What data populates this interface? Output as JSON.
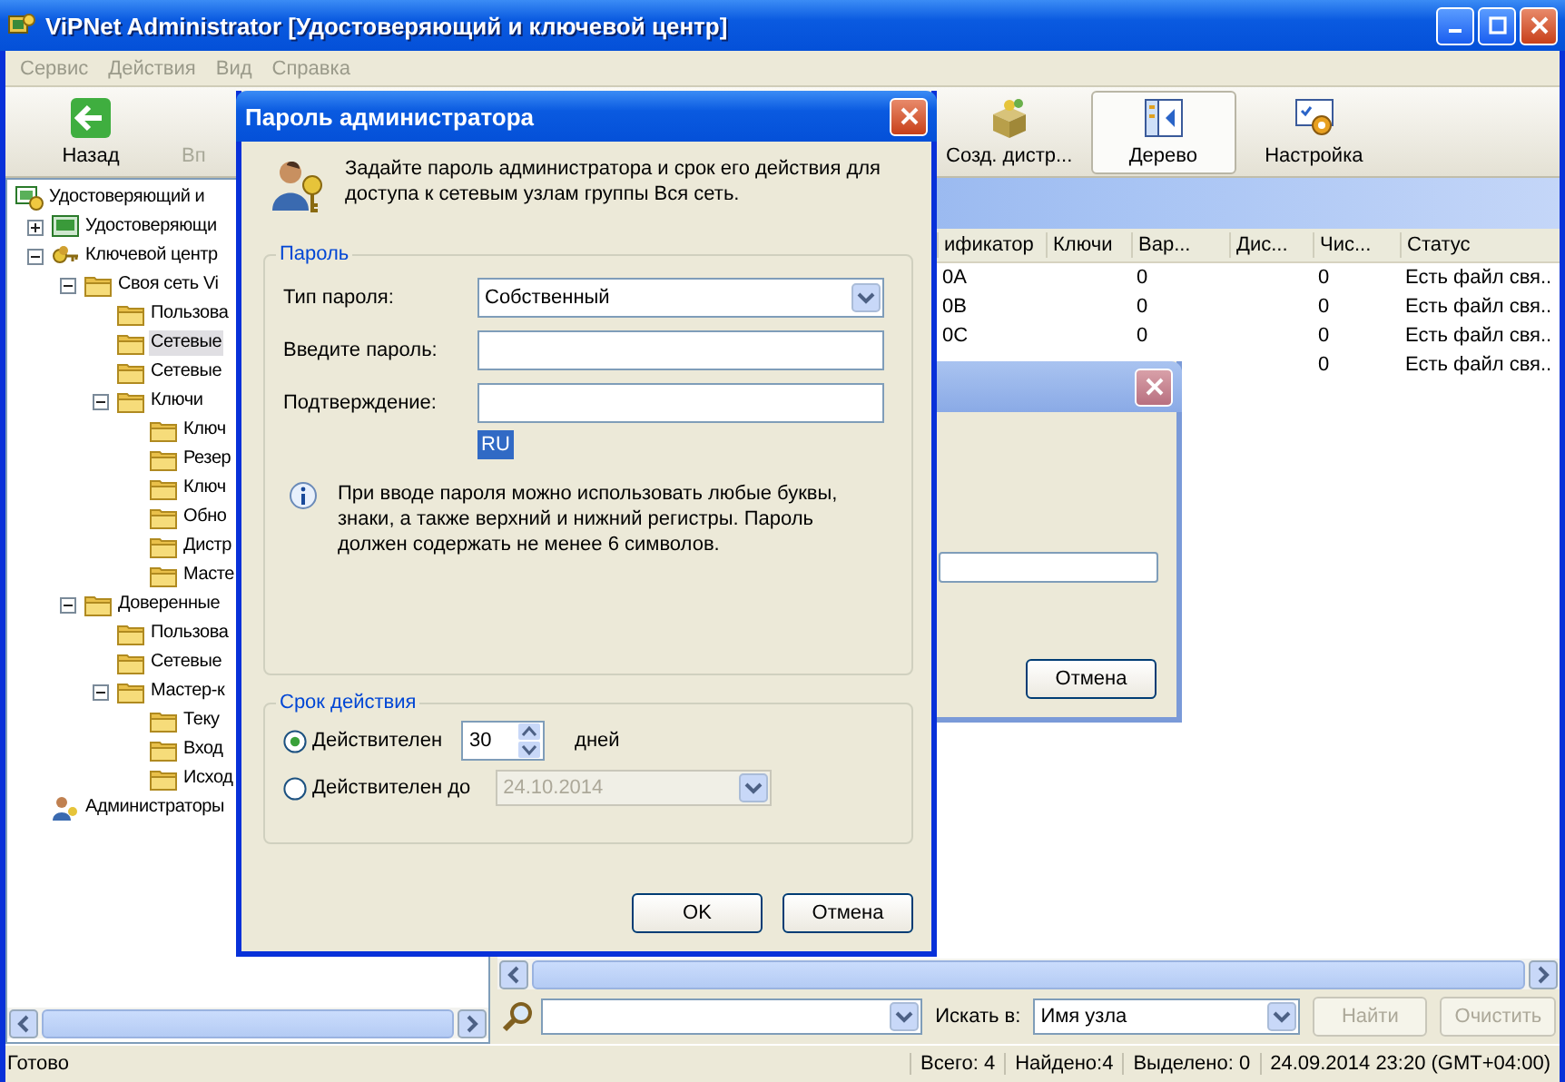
{
  "window": {
    "title": "ViPNet Administrator [Удостоверяющий и ключевой центр]"
  },
  "menu": [
    {
      "label": "Сервис",
      "disabled": true
    },
    {
      "label": "Действия",
      "disabled": true
    },
    {
      "label": "Вид",
      "disabled": true
    },
    {
      "label": "Справка",
      "disabled": true
    }
  ],
  "toolbar": {
    "left": [
      {
        "label": "Назад",
        "disabled": false,
        "selected": false
      },
      {
        "label": "Вп",
        "disabled": true,
        "selected": false
      }
    ],
    "right": [
      {
        "label": "Созд. дистр...",
        "disabled": false,
        "selected": false
      },
      {
        "label": "Дерево",
        "disabled": false,
        "selected": true
      },
      {
        "label": "Настройка",
        "disabled": false,
        "selected": false
      }
    ]
  },
  "tree": [
    {
      "label": "Удостоверяющий и",
      "kind": "root",
      "selected": false,
      "children": [
        {
          "label": "Удостоверяющи",
          "kind": "center",
          "selected": false,
          "expanded": false
        },
        {
          "label": "Ключевой центр",
          "kind": "keys",
          "selected": false,
          "expanded": true,
          "children": [
            {
              "label": "Своя сеть Vi",
              "kind": "folder",
              "selected": false,
              "expanded": true,
              "children": [
                {
                  "label": "Пользова",
                  "kind": "folder",
                  "selected": false
                },
                {
                  "label": "Сетевые",
                  "kind": "folder",
                  "selected": true
                },
                {
                  "label": "Сетевые",
                  "kind": "folder",
                  "selected": false
                },
                {
                  "label": "Ключи",
                  "kind": "folder",
                  "selected": false,
                  "expanded": true,
                  "children": [
                    {
                      "label": "Ключ",
                      "kind": "folder",
                      "selected": false
                    },
                    {
                      "label": "Резер",
                      "kind": "folder",
                      "selected": false
                    },
                    {
                      "label": "Ключ",
                      "kind": "folder",
                      "selected": false
                    },
                    {
                      "label": "Обно",
                      "kind": "folder",
                      "selected": false
                    },
                    {
                      "label": "Дистр",
                      "kind": "folder",
                      "selected": false
                    },
                    {
                      "label": "Масте",
                      "kind": "folder",
                      "selected": false
                    }
                  ]
                }
              ]
            },
            {
              "label": "Доверенные",
              "kind": "folder",
              "selected": false,
              "expanded": true,
              "children": [
                {
                  "label": "Пользова",
                  "kind": "folder",
                  "selected": false
                },
                {
                  "label": "Сетевые",
                  "kind": "folder",
                  "selected": false
                },
                {
                  "label": "Мастер-к",
                  "kind": "folder",
                  "selected": false,
                  "expanded": true,
                  "children": [
                    {
                      "label": "Теку",
                      "kind": "folder",
                      "selected": false
                    },
                    {
                      "label": "Вход",
                      "kind": "folder",
                      "selected": false
                    },
                    {
                      "label": "Исход",
                      "kind": "folder",
                      "selected": false
                    }
                  ]
                }
              ]
            }
          ]
        },
        {
          "label": "Администраторы",
          "kind": "admins",
          "selected": false
        }
      ]
    }
  ],
  "table": {
    "columns": [
      "ификатор",
      "Ключи",
      "Вар...",
      "Дис...",
      "Чис...",
      "Статус"
    ],
    "rows": [
      [
        "0A",
        null,
        "0",
        null,
        "0",
        "Есть файл свя.."
      ],
      [
        "0B",
        null,
        "0",
        null,
        "0",
        "Есть файл свя.."
      ],
      [
        "0C",
        null,
        "0",
        null,
        "0",
        "Есть файл свя.."
      ],
      [
        null,
        null,
        null,
        null,
        "0",
        "Есть файл свя.."
      ]
    ]
  },
  "search": {
    "search_in_label": "Искать в:",
    "search_in_value": "Имя узла",
    "buttons": [
      {
        "label": "Найти",
        "disabled": true
      },
      {
        "label": "Очистить",
        "disabled": true
      }
    ]
  },
  "status_bar": [
    "Готово",
    "Всего: 4",
    "Найдено:4",
    "Выделено: 0",
    "24.09.2014 23:20 (GMT+04:00)"
  ],
  "background_dialog": {
    "button": "Отмена"
  },
  "dialog": {
    "title": "Пароль администратора",
    "intro": "Задайте пароль администратора и срок его действия для доступа к сетевым узлам группы Вся сеть.",
    "password_group": {
      "title": "Пароль",
      "type_label": "Тип пароля:",
      "type_value": "Собственный",
      "password_label": "Введите пароль:",
      "confirm_label": "Подтверждение:",
      "keyboard_layout": "RU",
      "hint": "При вводе пароля можно использовать любые буквы, знаки, а также верхний и нижний регистры. Пароль должен содержать не менее 6 символов."
    },
    "validity_group": {
      "title": "Срок действия",
      "options": [
        {
          "label": "Действителен",
          "selected": true
        },
        {
          "label": "Действителен до",
          "selected": false
        }
      ],
      "days_value": "30",
      "days_unit": "дней",
      "date_value": "24.10.2014",
      "date_disabled": true
    },
    "buttons": [
      "OK",
      "Отмена"
    ]
  }
}
